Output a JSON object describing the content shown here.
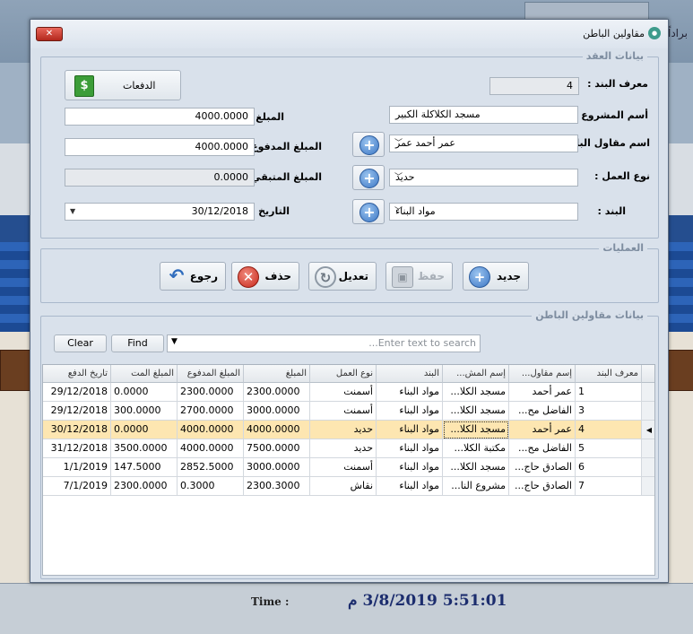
{
  "background": {
    "top_text": "براداً",
    "time_label": "Time :",
    "time_value": "5:51:01 3/8/2019 م"
  },
  "window": {
    "title": "مقاولين الباطن",
    "close_label": "✕"
  },
  "contract": {
    "legend": "بيانات العقد",
    "payments_label": "الدفعات",
    "item_id_label": "معرف البند :",
    "item_id_value": "4",
    "project_label": "أسم المشروع :",
    "project_value": "مسجد الكلاكلة الكبير",
    "amount_label": "المبلغ :",
    "amount_value": "4000.0000",
    "subcontractor_label": "اسم مقاول الباطن :",
    "subcontractor_value": "عمر أحمد عمر",
    "paid_label": "المبلغ المدفوع :",
    "paid_value": "4000.0000",
    "work_type_label": "نوع العمل :",
    "work_type_value": "حديد",
    "remaining_label": "المبلغ المتبقي :",
    "remaining_value": "0.0000",
    "item_label": "البند :",
    "item_value": "مواد البناء",
    "date_label": "التاريخ :",
    "date_value": "30/12/2018"
  },
  "operations": {
    "legend": "العمليات",
    "new_label": "جديد",
    "save_label": "حفظ",
    "edit_label": "تعديل",
    "delete_label": "حذف",
    "back_label": "رجوع"
  },
  "subcontractors": {
    "legend": "بيانات مقاولين الباطن",
    "clear_label": "Clear",
    "find_label": "Find",
    "search_placeholder": "...Enter text to search",
    "columns": [
      "معرف البند",
      "إسم مقاول...",
      "إسم المش...",
      "البند",
      "نوع العمل",
      "المبلغ",
      "المبلغ المدفوع",
      "المبلغ المت",
      "تاريخ الدفع"
    ],
    "rows": [
      [
        "1",
        "عمر أحمد",
        "مسجد الكلا...",
        "مواد البناء",
        "أسمنت",
        "2300.0000",
        "2300.0000",
        "0.0000",
        "29/12/2018"
      ],
      [
        "3",
        "الفاضل مح...",
        "مسجد الكلا...",
        "مواد البناء",
        "أسمنت",
        "3000.0000",
        "2700.0000",
        "300.0000",
        "29/12/2018"
      ],
      [
        "4",
        "عمر أحمد",
        "مسجد الكلا...",
        "مواد البناء",
        "حديد",
        "4000.0000",
        "4000.0000",
        "0.0000",
        "30/12/2018"
      ],
      [
        "5",
        "الفاضل مح...",
        "مكتبة الكلا...",
        "مواد البناء",
        "حديد",
        "7500.0000",
        "4000.0000",
        "3500.0000",
        "31/12/2018"
      ],
      [
        "6",
        "الصادق حاج...",
        "مسجد الكلا...",
        "مواد البناء",
        "أسمنت",
        "3000.0000",
        "2852.5000",
        "147.5000",
        "1/1/2019"
      ],
      [
        "7",
        "الصادق حاج...",
        "مشروع النا...",
        "مواد البناء",
        "نقاش",
        "2300.3000",
        "0.3000",
        "2300.0000",
        "7/1/2019"
      ]
    ],
    "selected_row": 2
  }
}
